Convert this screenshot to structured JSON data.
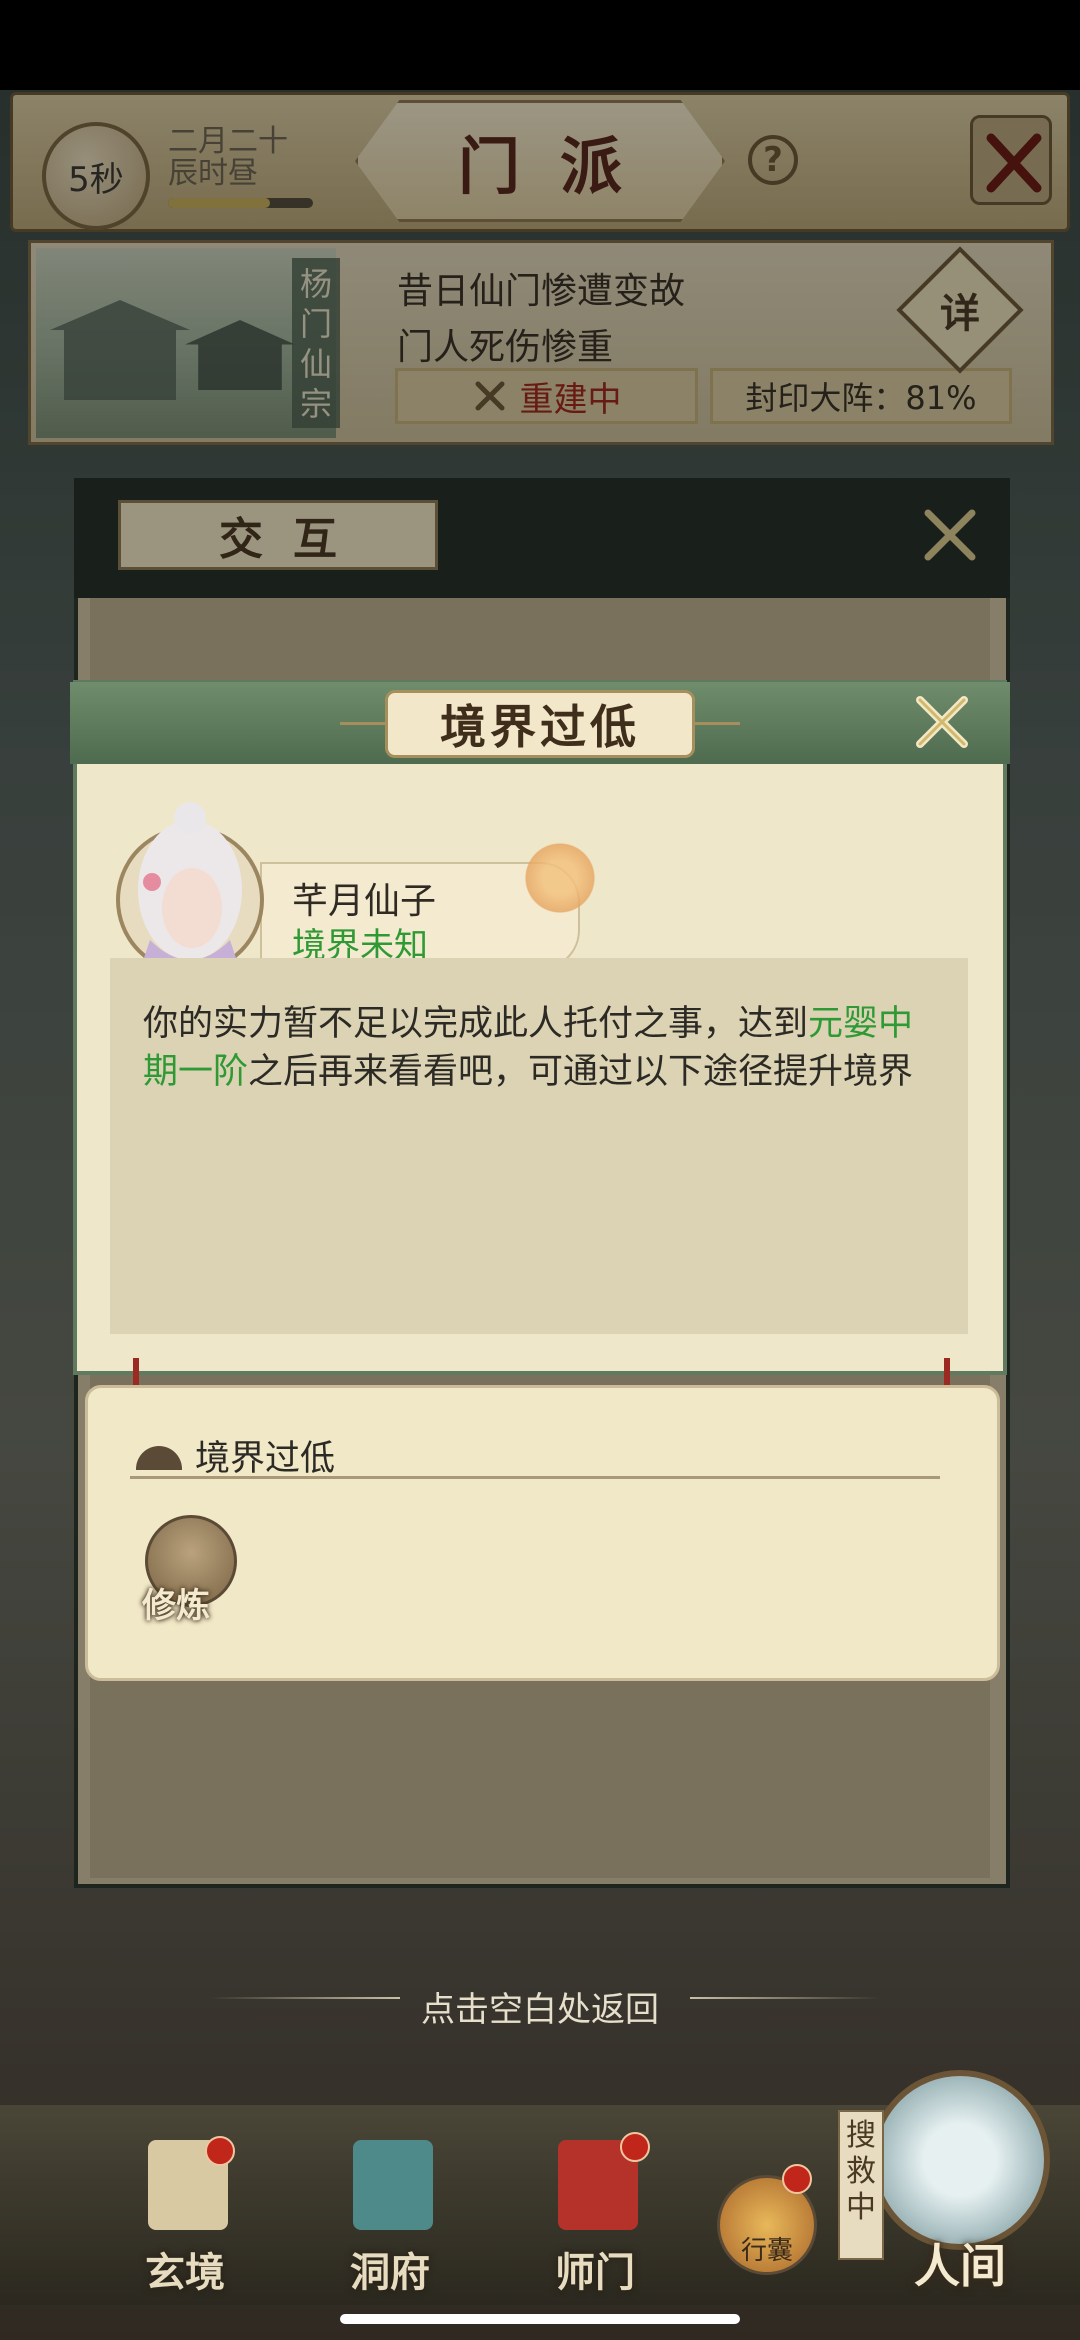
{
  "header": {
    "timer": "5秒",
    "date_line1": "二月二十",
    "date_line2": "辰时昼",
    "date_progress": 0.7,
    "title": "门派",
    "help_label": "?"
  },
  "banner": {
    "sect_name": "杨门仙宗",
    "line1": "昔日仙门惨遭变故",
    "line2": "门人死伤惨重",
    "rebuild_label": "重建中",
    "seal_label": "封印大阵：81%",
    "detail_label": "详"
  },
  "back_panel": {
    "title": "交互"
  },
  "dialog": {
    "title": "境界过低",
    "npc_name": "芊月仙子",
    "npc_realm": "境界未知",
    "message_part1": "你的实力暂不足以完成此人托付之事，达到",
    "message_highlight": "元婴中期一阶",
    "message_part2": "之后再来看看吧，可通过以下途径提升境界"
  },
  "lower": {
    "title": "境界过低",
    "train_label": "修炼"
  },
  "hint": "点击空白处返回",
  "nav": {
    "items": [
      {
        "label": "玄境",
        "color": "#d8c9a3",
        "badge": true
      },
      {
        "label": "洞府",
        "color": "#4e8a8a",
        "badge": false
      },
      {
        "label": "师门",
        "color": "#b5322a",
        "badge": true
      }
    ],
    "bag_label": "行囊",
    "search_tag": "搜救中",
    "world_label": "人间"
  },
  "colors": {
    "accent_green": "#2f9a35",
    "accent_red": "#a02a1c",
    "dialog_header": "#5f7a5f"
  }
}
